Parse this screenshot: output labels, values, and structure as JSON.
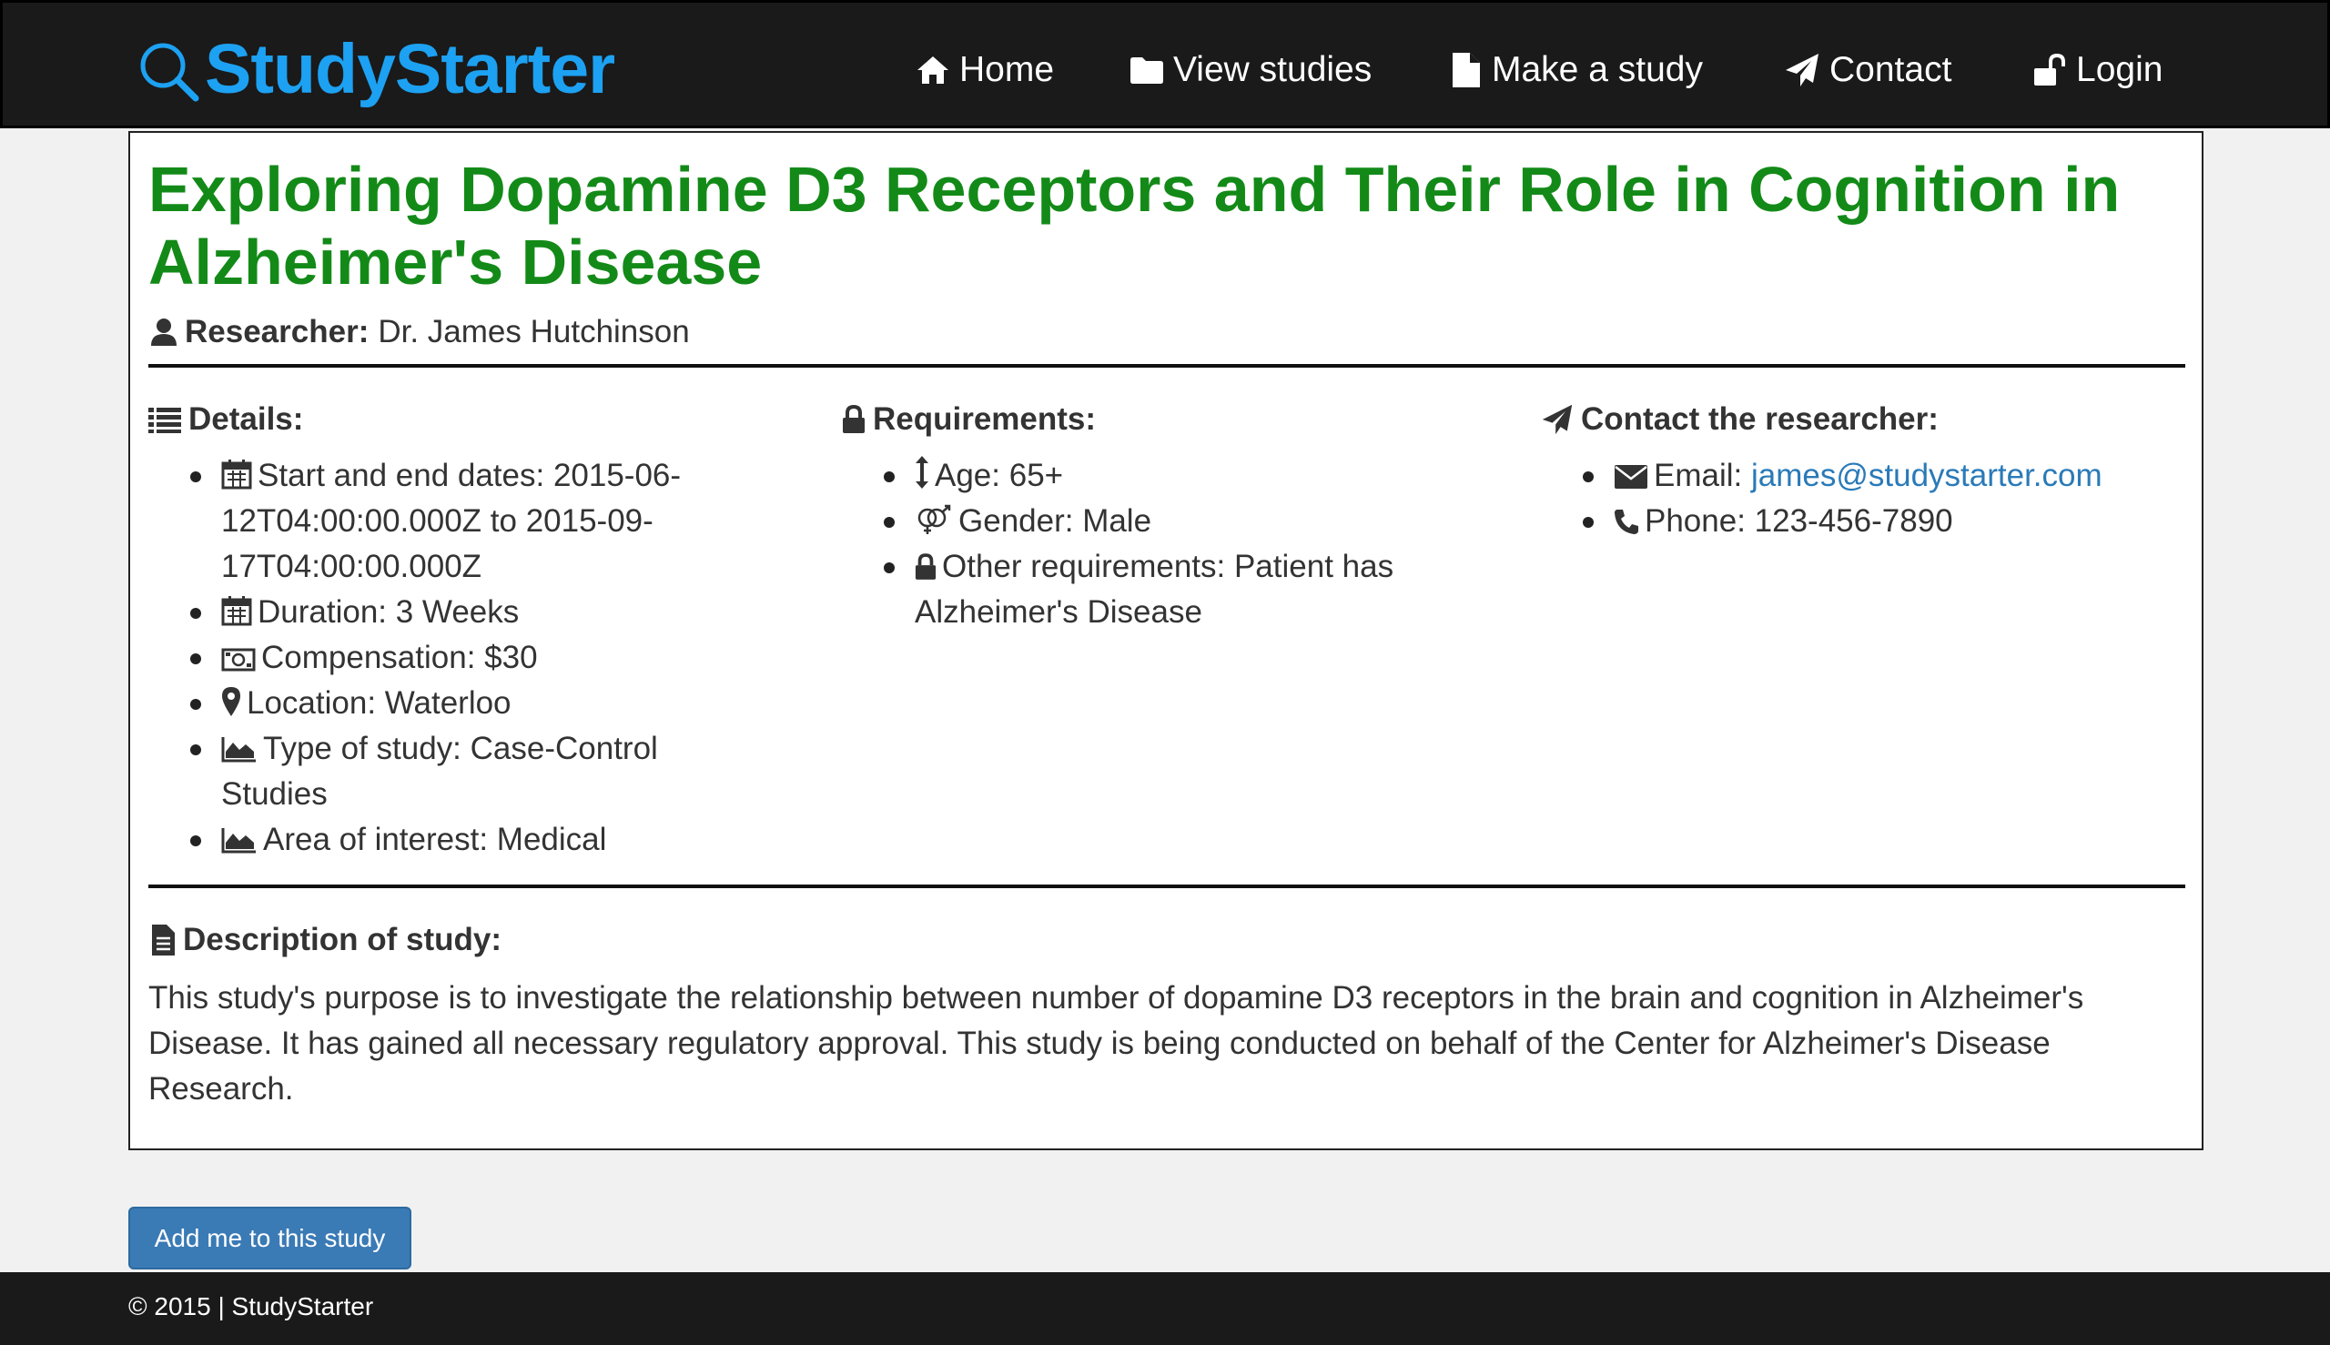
{
  "brand": {
    "name": "StudyStarter",
    "color": "#1da1f2"
  },
  "nav": {
    "items": [
      {
        "label": "Home",
        "icon": "home-icon"
      },
      {
        "label": "View studies",
        "icon": "folder-icon"
      },
      {
        "label": "Make a study",
        "icon": "file-icon"
      },
      {
        "label": "Contact",
        "icon": "paper-plane-icon"
      },
      {
        "label": "Login",
        "icon": "unlock-icon"
      }
    ]
  },
  "study": {
    "title": "Exploring Dopamine D3 Receptors and Their Role in Cognition in Alzheimer's Disease",
    "title_color": "#138a18",
    "researcher_label": "Researcher:",
    "researcher_name": "Dr. James Hutchinson",
    "details": {
      "heading": "Details:",
      "dates": "Start and end dates: 2015-06-12T04:00:00.000Z to 2015-09-17T04:00:00.000Z",
      "duration": "Duration: 3 Weeks",
      "compensation": "Compensation: $30",
      "location": "Location: Waterloo",
      "type": "Type of study: Case-Control Studies",
      "area": "Area of interest: Medical"
    },
    "requirements": {
      "heading": "Requirements:",
      "age": "Age: 65+",
      "gender": "Gender: Male",
      "other": "Other requirements: Patient has Alzheimer's Disease"
    },
    "contact": {
      "heading": "Contact the researcher:",
      "email_label": "Email:",
      "email": "james@studystarter.com",
      "phone": "Phone: 123-456-7890"
    },
    "description": {
      "heading": "Description of study:",
      "body": "This study's purpose is to investigate the relationship between number of dopamine D3 receptors in the brain and cognition in Alzheimer's Disease. It has gained all necessary regulatory approval. This study is being conducted on behalf of the Center for Alzheimer's Disease Research."
    }
  },
  "actions": {
    "add_label": "Add me to this study"
  },
  "footer": {
    "text": "© 2015 | StudyStarter"
  }
}
